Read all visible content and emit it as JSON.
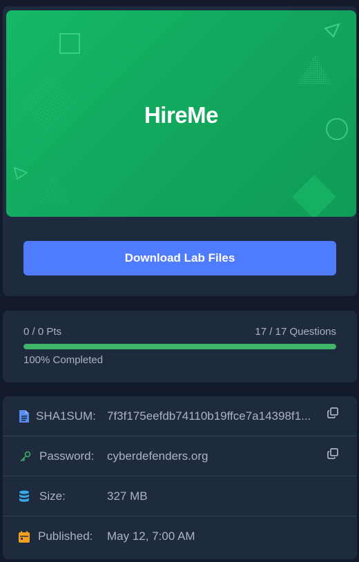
{
  "lab": {
    "banner_title": "HireMe",
    "download_label": "Download Lab Files"
  },
  "progress": {
    "points": "0 / 0 Pts",
    "questions": "17 / 17 Questions",
    "completed": "100% Completed",
    "fraction": 1.0
  },
  "info": {
    "sha1_label": "SHA1SUM:",
    "sha1_value": "7f3f175eefdb74110b19ffce7a14398f1...",
    "password_label": "Password:",
    "password_value": "cyberdefenders.org",
    "size_label": "Size:",
    "size_value": "327 MB",
    "published_label": "Published:",
    "published_value": "May 12, 7:00 AM"
  },
  "icons": {
    "sha1": "file-icon",
    "password": "key-icon",
    "size": "database-icon",
    "published": "calendar-icon",
    "copy": "copy-icon"
  },
  "colors": {
    "banner": "#14b062",
    "button": "#4f7cff",
    "progress": "#3fb56a",
    "file_icon": "#5b8def",
    "key_icon": "#3fb56a",
    "db_icon": "#3aa7e8",
    "calendar_icon": "#f0a01e"
  }
}
